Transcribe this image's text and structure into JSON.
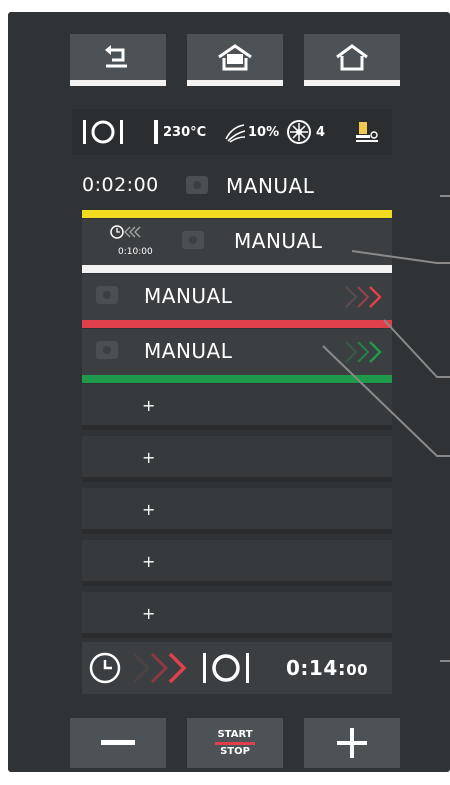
{
  "status": {
    "temperature": "230°C",
    "humidity": "10%",
    "fan_speed": "4"
  },
  "phases": [
    {
      "time": "0:02:00",
      "label": "MANUAL",
      "color": "#f3dc1f"
    },
    {
      "delay": "0:10:00",
      "label": "MANUAL",
      "color": "#f2f2f2"
    },
    {
      "label": "MANUAL",
      "color": "#e0404c"
    },
    {
      "label": "MANUAL",
      "color": "#1e9a4a"
    }
  ],
  "add_step_label": "+",
  "totals": {
    "time_main": "0:14:",
    "time_seconds": "00"
  },
  "start_stop": {
    "start": "START",
    "stop": "STOP"
  },
  "icons": [
    "back-icon",
    "my-home-icon",
    "home-icon",
    "plate-icon",
    "thermometer-icon",
    "humidity-icon",
    "fan-icon",
    "probe-icon",
    "camera-icon",
    "timer-icon",
    "chevrons-icon",
    "minus-icon",
    "plus-icon"
  ]
}
